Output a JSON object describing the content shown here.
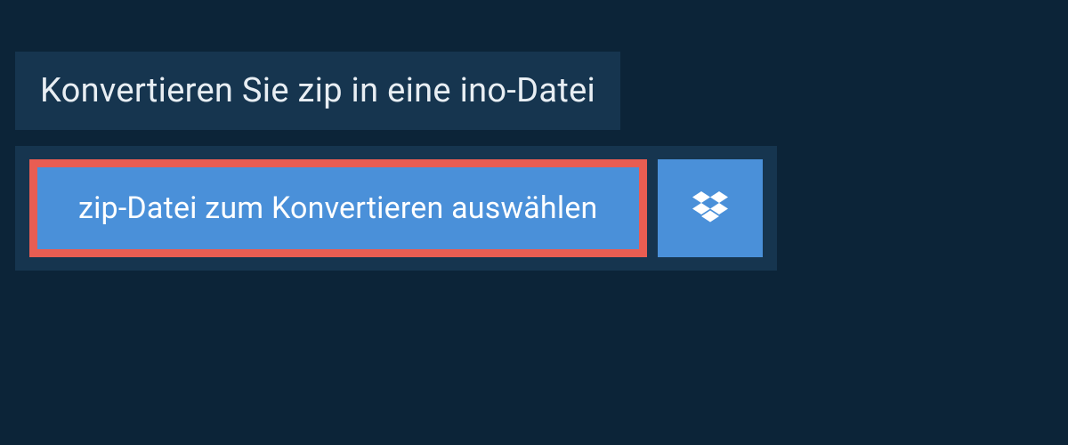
{
  "header": {
    "title": "Konvertieren Sie zip in eine ino-Datei"
  },
  "upload": {
    "choose_file_label": "zip-Datei zum Konvertieren auswählen"
  },
  "colors": {
    "background": "#0c2438",
    "panel": "#16354f",
    "button": "#4a90d9",
    "highlight_border": "#e85d52",
    "text_light": "#e8eef3"
  }
}
